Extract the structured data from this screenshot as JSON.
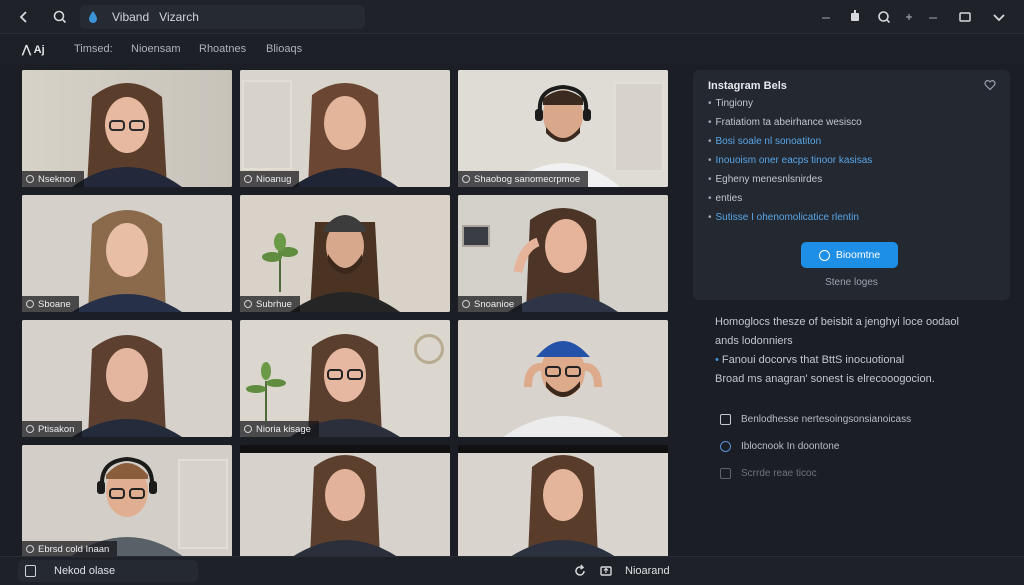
{
  "topbar": {
    "address_text": "Viband   Vizarch",
    "back_icon": "back-arrow-icon",
    "search_icon": "search-icon"
  },
  "tabs": [
    {
      "label": "Aj"
    },
    {
      "label": "Timsed:"
    },
    {
      "label": "Nioensam"
    },
    {
      "label": "Rhoatnes"
    },
    {
      "label": "Blioaqs"
    }
  ],
  "tiles": [
    {
      "name": "Nseknon"
    },
    {
      "name": "Nioanug"
    },
    {
      "name": "Shaobog sanomecrpmoe"
    },
    {
      "name": "Sboane"
    },
    {
      "name": "Subrhue"
    },
    {
      "name": "Snoanioe"
    },
    {
      "name": "Ptisakon"
    },
    {
      "name": "Nioria kisage"
    },
    {
      "name": ""
    },
    {
      "name": "Ebrsd cold Inaan"
    },
    {
      "name": ""
    },
    {
      "name": ""
    }
  ],
  "panel": {
    "title": "Instagram Bels",
    "items": [
      {
        "text": "Tingiony",
        "accent": false
      },
      {
        "text": "Fratiatiom ta abeirhance wesisco",
        "accent": false
      },
      {
        "text": "Bosi soale nl sonoatiton",
        "accent": true
      },
      {
        "text": "Inouoism oner eacps tinoor kasisas",
        "accent": true
      },
      {
        "text": "Egheny menesnlsnirdes",
        "accent": false
      },
      {
        "text": "enties",
        "accent": false
      },
      {
        "text": "Sutisse I ohenomolicatice rlentin",
        "accent": true
      }
    ],
    "cta_label": "Bioomtne",
    "subtext": "Stene loges"
  },
  "lower": {
    "line1": "Homoglocs thesze of beisbit a jenghyi loce oodaol",
    "line2": "ands lodonniers",
    "line3": "Fanoui docorvs that BttS inocuotional",
    "line4": "Broad ms anagran' sonest is elrecooogocion."
  },
  "options": [
    {
      "label": "Benlodhesse nertesoingsonsianoicass"
    },
    {
      "label": "Iblocnook In doontone"
    },
    {
      "label": "Scrrde reae ticoc"
    }
  ],
  "bottombar": {
    "left_label": "Nekod olase",
    "right_label": "Nioarand"
  },
  "colors": {
    "accent_blue": "#1d8fe6",
    "active_speaker": "#e7d24a",
    "selected_tile": "#3b93d8"
  }
}
